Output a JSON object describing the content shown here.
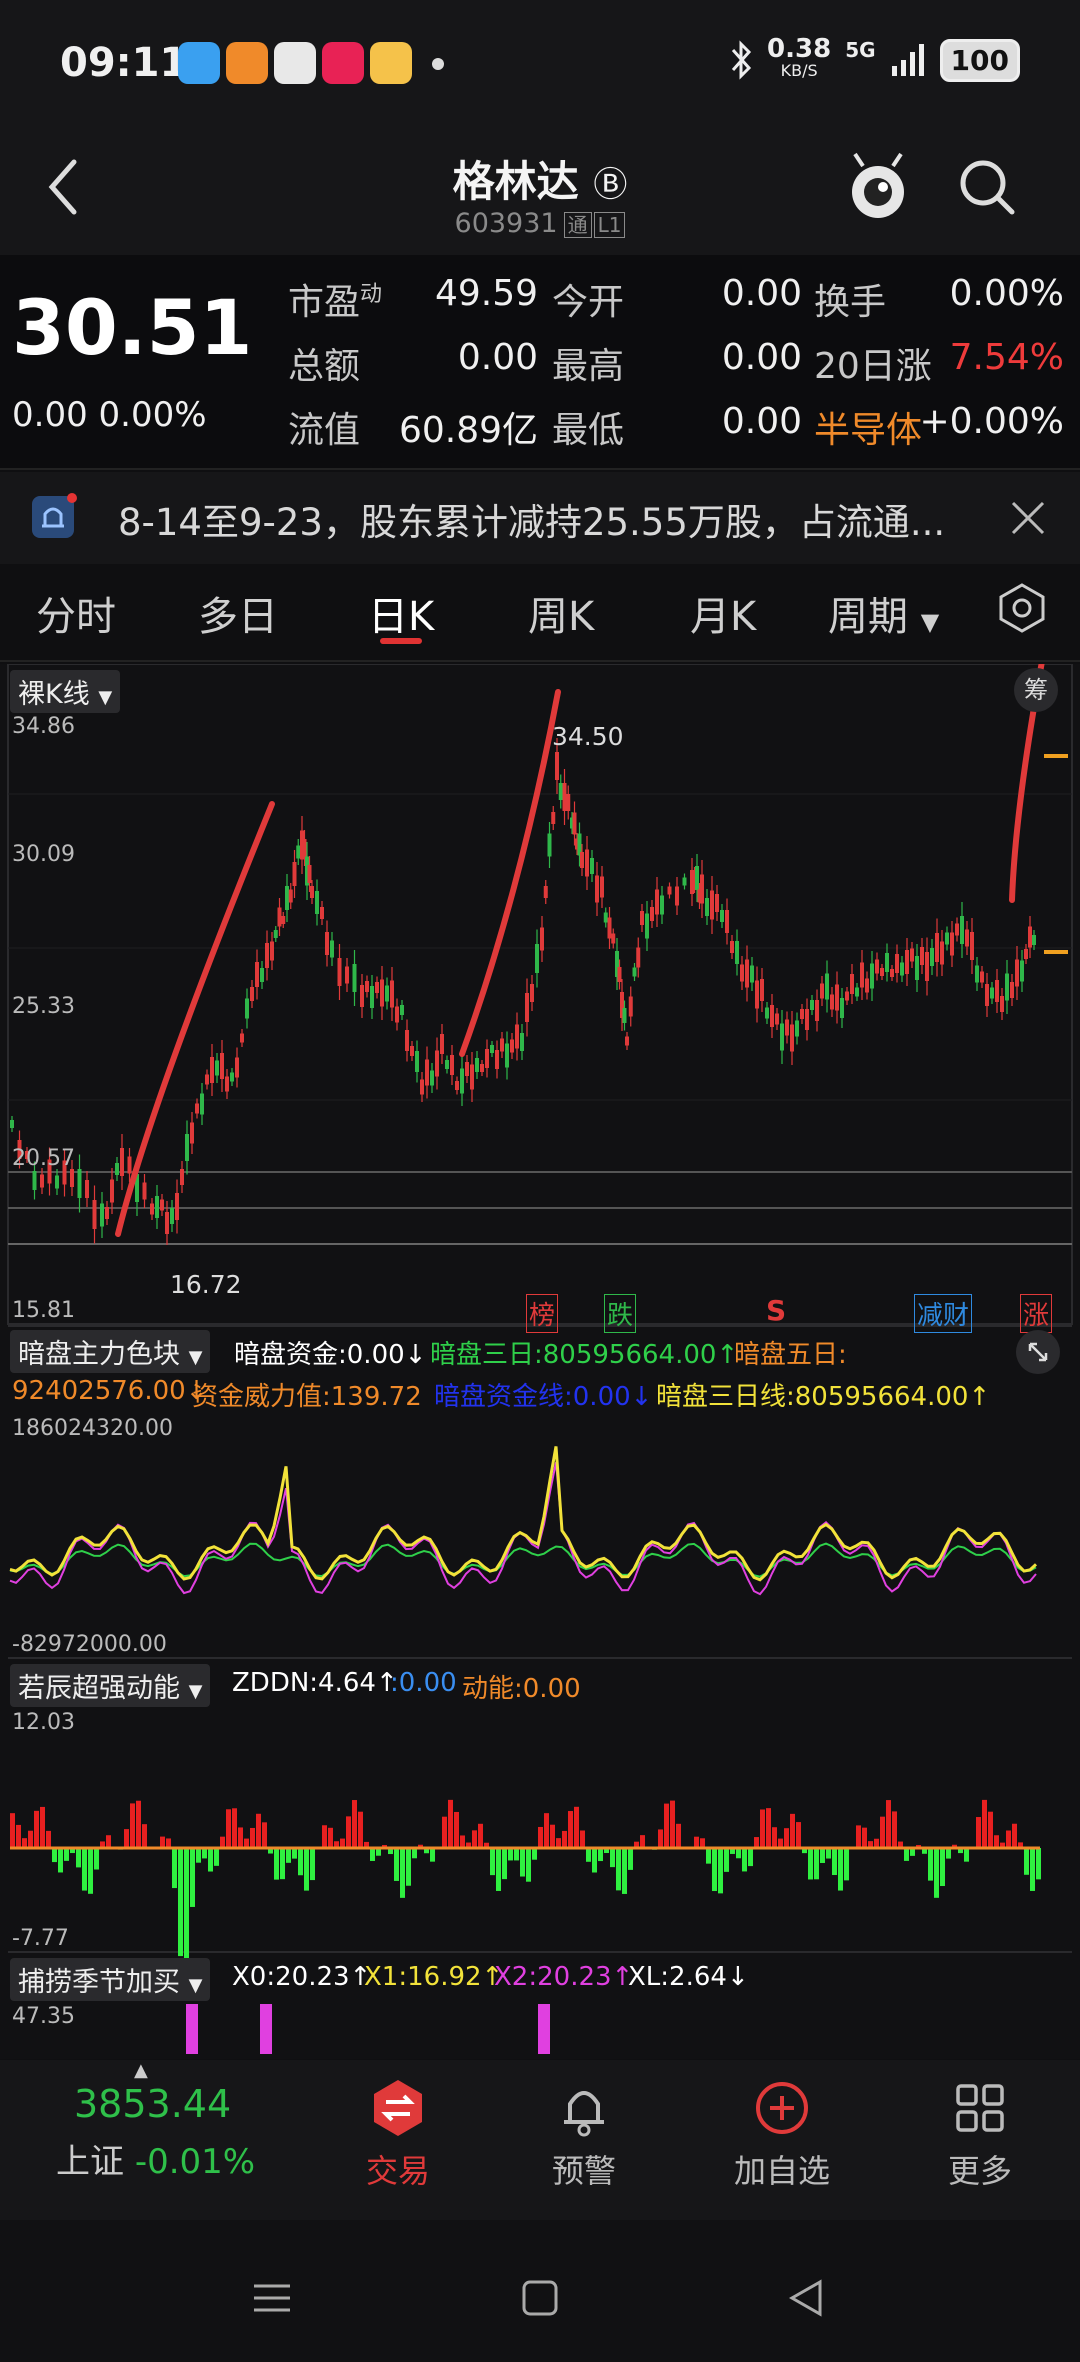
{
  "status": {
    "time": "09:11",
    "speed_value": "0.38",
    "speed_unit": "KB/S",
    "network": "5G",
    "battery": "100"
  },
  "header": {
    "title": "格林达",
    "badge": "Ⓑ",
    "code": "603931",
    "tag1": "通",
    "tag2": "L1"
  },
  "quote": {
    "price": "30.51",
    "change": "0.00 0.00%",
    "rows": [
      [
        {
          "label": "市盈",
          "sup": "动",
          "value": "49.59"
        },
        {
          "label": "今开",
          "value": "0.00"
        },
        {
          "label": "换手",
          "value": "0.00%"
        }
      ],
      [
        {
          "label": "总额",
          "value": "0.00"
        },
        {
          "label": "最高",
          "value": "0.00"
        },
        {
          "label": "20日涨",
          "value": "7.54%"
        }
      ],
      [
        {
          "label": "流值",
          "value": "60.89亿"
        },
        {
          "label": "最低",
          "value": "0.00"
        },
        {
          "label": "半导体",
          "value": "+0.00%"
        }
      ]
    ],
    "colors": {
      "up": "#ef3b3b",
      "sector": "#f08a2a",
      "label": "#c8c8c8"
    }
  },
  "notice": {
    "text": "8-14至9-23，股东累计减持25.55万股，占流通..."
  },
  "tabs": [
    {
      "label": "分时"
    },
    {
      "label": "多日"
    },
    {
      "label": "日K",
      "active": true
    },
    {
      "label": "周K"
    },
    {
      "label": "月K"
    },
    {
      "label": "周期"
    }
  ],
  "kline": {
    "dropdown": "裸K线",
    "chip_label": "筹",
    "axis_labels": [
      "34.86",
      "30.09",
      "25.33",
      "20.57",
      "15.81"
    ],
    "high_label": "34.50",
    "low_label": "16.72",
    "markers": [
      {
        "text": "榜",
        "color": "#e03a3a"
      },
      {
        "text": "跌",
        "color": "#2fb84a"
      },
      {
        "text": "S",
        "color": "#e03a3a"
      },
      {
        "text": "减财",
        "color": "#2f8ae0"
      },
      {
        "text": "涨",
        "color": "#e03a3a"
      }
    ]
  },
  "ind1": {
    "dropdown": "暗盘主力色块",
    "line1": [
      {
        "text": "暗盘资金:0.00↓",
        "color": "#ffffff"
      },
      {
        "text": "暗盘三日:80595664.00↑",
        "color": "#2fd04a"
      },
      {
        "text": "暗盘五日:",
        "color": "#f08a2a"
      }
    ],
    "line2": [
      {
        "text": "92402576.00↓",
        "color": "#f08a2a"
      },
      {
        "text": "资金威力值:139.72",
        "color": "#f08a2a"
      },
      {
        "text": "暗盘资金线:0.00↓",
        "color": "#2233ee"
      },
      {
        "text": "暗盘三日线:80595664.00↑",
        "color": "#f2e23a"
      }
    ],
    "axis_top": "186024320.00",
    "axis_bottom": "-82972000.00"
  },
  "ind2": {
    "dropdown": "若辰超强动能",
    "values": [
      {
        "text": "ZDDN:4.64↑",
        "color": "#ffffff"
      },
      {
        "text": ":0.00",
        "color": "#3a8ef0"
      },
      {
        "text": "动能:0.00",
        "color": "#f08a2a"
      }
    ],
    "axis_top": "12.03",
    "axis_bottom": "-7.77"
  },
  "ind3": {
    "dropdown": "捕捞季节加买",
    "values": [
      {
        "text": "X0:20.23↑",
        "color": "#ffffff"
      },
      {
        "text": "X1:16.92↑",
        "color": "#f2e23a"
      },
      {
        "text": "X2:20.23↑",
        "color": "#e040e0"
      },
      {
        "text": "XL:2.64↓",
        "color": "#ffffff"
      }
    ],
    "axis_top": "47.35"
  },
  "bottom_nav": {
    "index_value": "3853.44",
    "index_name": "上证",
    "index_change": "-0.01%",
    "items": [
      {
        "label": "交易"
      },
      {
        "label": "预警"
      },
      {
        "label": "加自选"
      },
      {
        "label": "更多"
      }
    ]
  }
}
